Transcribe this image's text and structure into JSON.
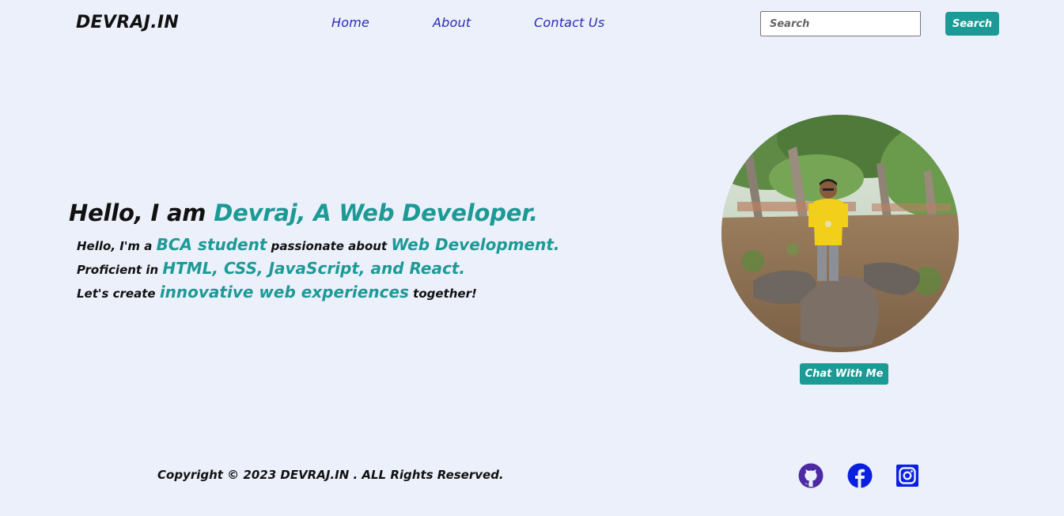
{
  "header": {
    "brand": "DEVRAJ.IN",
    "nav": [
      {
        "label": "Home"
      },
      {
        "label": "About"
      },
      {
        "label": "Contact Us"
      }
    ],
    "search": {
      "placeholder": "Search",
      "value": "",
      "button_label": "Search"
    }
  },
  "hero": {
    "title_prefix": "Hello, I am",
    "title_accent": "Devraj, A Web Developer.",
    "line1": {
      "pre": "Hello, I'm a",
      "accent1": "BCA student",
      "mid": "passionate about",
      "accent2": "Web Development."
    },
    "line2": {
      "pre": "Proficient in",
      "accent": "HTML, CSS, JavaScript, and React."
    },
    "line3": {
      "pre": "Let's create",
      "accent": "innovative web experiences",
      "post": "together!"
    },
    "chat_button": "Chat With Me"
  },
  "footer": {
    "copyright": "Copyright © 2023 DEVRAJ.IN . ALL Rights Reserved.",
    "social": [
      {
        "icon": "github-icon",
        "color": "#4b2aa3"
      },
      {
        "icon": "facebook-icon",
        "color": "#0a1fe0"
      },
      {
        "icon": "instagram-icon",
        "color": "#0a1fe0"
      }
    ]
  },
  "colors": {
    "background": "#ecf0fb",
    "accent": "#1c9a96",
    "nav_link": "#2a2ab8"
  }
}
